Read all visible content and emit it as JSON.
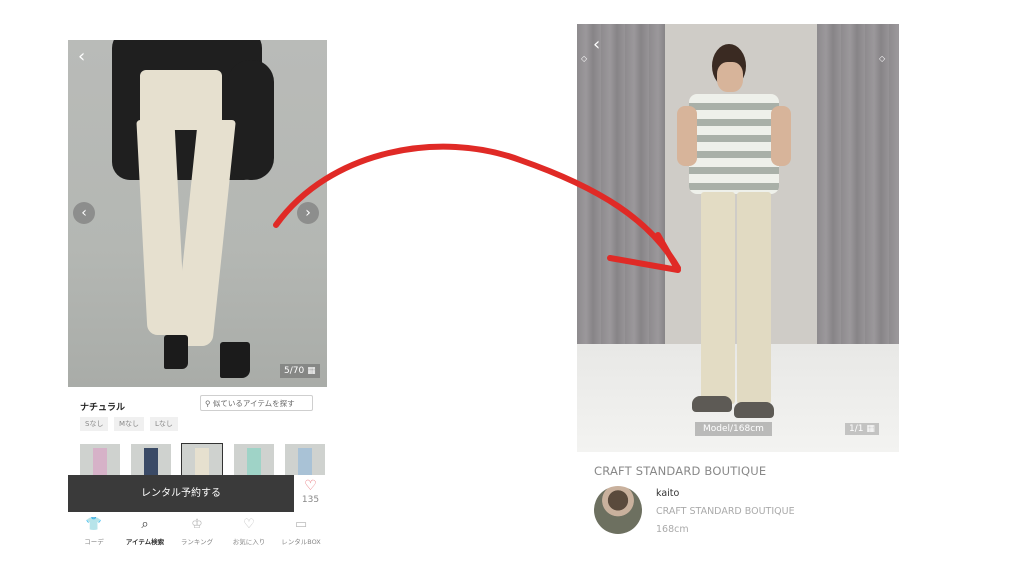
{
  "left": {
    "photo_counter": "5/70",
    "color_label": "ナチュラル",
    "search_similar": "似ているアイテムを探す",
    "sizes": [
      "Sなし",
      "Mなし",
      "Lなし"
    ],
    "thumbnails": [
      {
        "name": "pink",
        "color": "#d6b2c8"
      },
      {
        "name": "navy",
        "color": "#3a4a66"
      },
      {
        "name": "natural",
        "color": "#e6e0cf",
        "selected": true
      },
      {
        "name": "mint",
        "color": "#9fd3c7"
      },
      {
        "name": "blue",
        "color": "#a9c2d6"
      }
    ],
    "rent_button": "レンタル予約する",
    "favorite_count": "135",
    "tabs": [
      {
        "label": "コーデ",
        "icon": "shirt-icon"
      },
      {
        "label": "アイテム検索",
        "icon": "search-icon",
        "active": true
      },
      {
        "label": "ランキング",
        "icon": "crown-icon"
      },
      {
        "label": "お気に入り",
        "icon": "heart-icon"
      },
      {
        "label": "レンタルBOX",
        "icon": "box-icon"
      }
    ]
  },
  "right": {
    "model_badge": "Model/168cm",
    "photo_counter": "1/1",
    "shop_title": "CRAFT STANDARD BOUTIQUE",
    "staff_name": "kaito",
    "staff_shop": "CRAFT STANDARD BOUTIQUE",
    "staff_height": "168cm"
  },
  "arrow_color": "#e02a26"
}
